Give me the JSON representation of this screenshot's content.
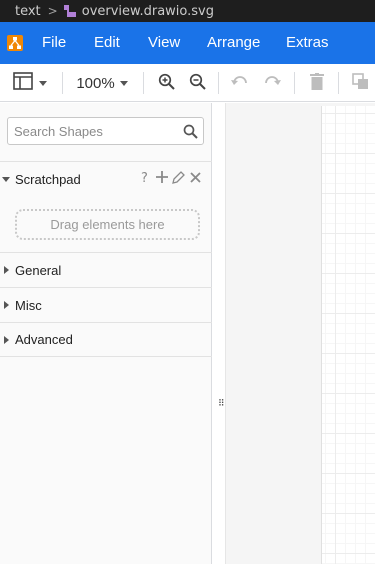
{
  "breadcrumb": {
    "folder": "text",
    "separator": ">",
    "file": "overview.drawio.svg"
  },
  "menubar": {
    "logo_icon": "drawio-logo-icon",
    "items": [
      "File",
      "Edit",
      "View",
      "Arrange",
      "Extras"
    ],
    "background": "#1a73e8"
  },
  "toolbar": {
    "format_panel_icon": "panel-layout-icon",
    "zoom_level": "100%",
    "zoom_in_icon": "zoom-in-icon",
    "zoom_out_icon": "zoom-out-icon",
    "undo_icon": "undo-icon",
    "redo_icon": "redo-icon",
    "delete_icon": "trash-icon",
    "duplicate_icon": "duplicate-icon"
  },
  "sidebar": {
    "search_placeholder": "Search Shapes",
    "scratchpad": {
      "title": "Scratchpad",
      "help": "?",
      "drop_hint": "Drag elements here"
    },
    "sections": [
      "General",
      "Misc",
      "Advanced"
    ]
  },
  "splitter": {
    "grip": "⠿"
  }
}
